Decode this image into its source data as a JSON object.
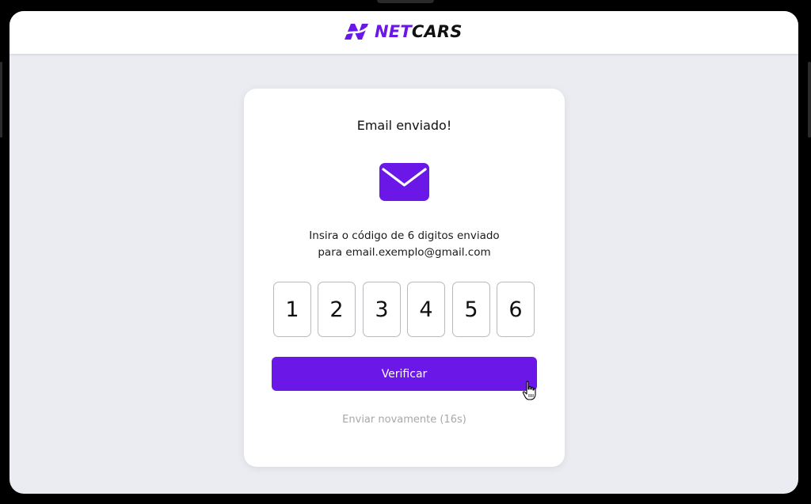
{
  "app": {
    "logo": {
      "part1": "NET",
      "part2": "CARS",
      "icon": "netcars-logo-icon"
    }
  },
  "card": {
    "title": "Email enviado!",
    "icon": "envelope-icon",
    "instructions": {
      "line1": "Insira o código de 6 digitos enviado",
      "line2": "para email.exemplo@gmail.com"
    },
    "code_digits": [
      "1",
      "2",
      "3",
      "4",
      "5",
      "6"
    ],
    "verify_label": "Verificar",
    "resend_label": "Enviar novamente (16s)"
  },
  "colors": {
    "accent": "#6b17e8",
    "background": "#ebecf1",
    "card": "#ffffff",
    "muted_text": "#a7a7ad"
  }
}
